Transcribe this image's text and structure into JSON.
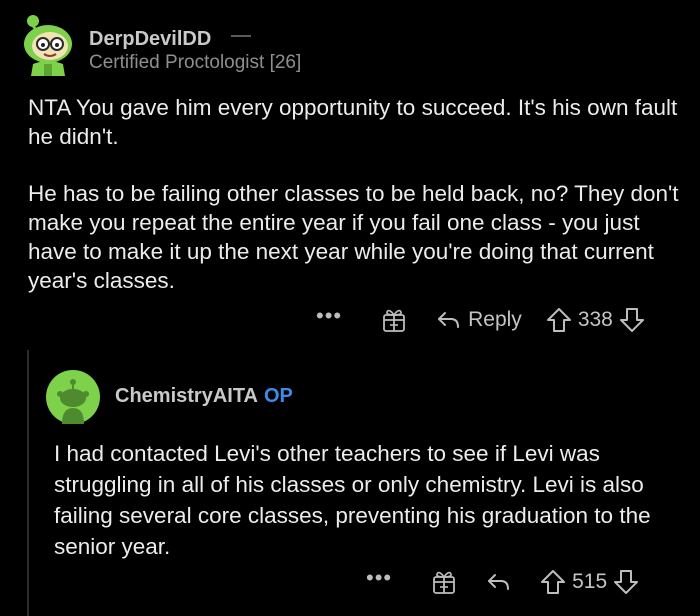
{
  "comment": {
    "author": "DerpDevilDD",
    "flair": "Certified Proctologist [26]",
    "paragraphs": [
      "NTA You gave him every opportunity to succeed. It's his own fault he didn't.",
      "He has to be failing other classes to be held back, no? They don't make you repeat the entire year if you fail one class - you just have to make it up the next year while you're doing that current year's classes."
    ],
    "actions": {
      "more_label": "•••",
      "reply_label": "Reply",
      "score": "338"
    }
  },
  "reply": {
    "author": "ChemistryAITA",
    "op_badge": "OP",
    "text": "I had contacted Levi's other teachers to see if Levi was struggling in all of his classes or only chemistry. Levi is also failing several core classes, preventing his graduation to the senior year.",
    "actions": {
      "more_label": "•••",
      "score": "515"
    }
  },
  "icons": {
    "gift": "gift-icon",
    "reply": "reply-arrow-icon",
    "upvote": "upvote-icon",
    "downvote": "downvote-icon",
    "more": "more-options-icon"
  },
  "colors": {
    "background": "#000000",
    "op_badge": "#3f8ae8",
    "avatar_1_bg": "#7ed14b",
    "avatar_2_bg": "#7ed14b"
  }
}
